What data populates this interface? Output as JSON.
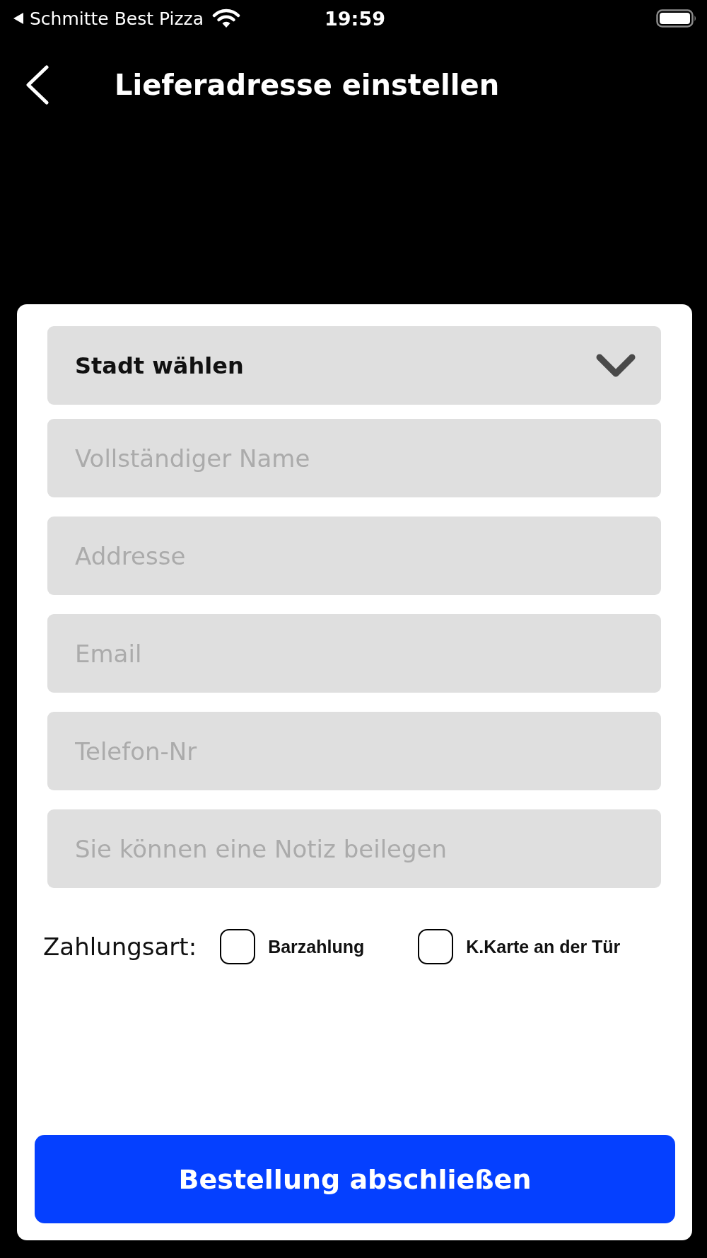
{
  "status_bar": {
    "back_app": "Schmitte Best Pizza",
    "time": "19:59"
  },
  "header": {
    "title": "Lieferadresse einstellen"
  },
  "form": {
    "city_select": {
      "label": "Stadt wählen"
    },
    "fields": [
      {
        "placeholder": "Vollständiger Name"
      },
      {
        "placeholder": "Addresse"
      },
      {
        "placeholder": "Email"
      },
      {
        "placeholder": "Telefon-Nr"
      },
      {
        "placeholder": "Sie können eine Notiz beilegen"
      }
    ],
    "payment": {
      "label": "Zahlungsart:",
      "options": [
        {
          "label": "Barzahlung",
          "checked": false
        },
        {
          "label": "K.Karte an der Tür",
          "checked": false
        }
      ]
    },
    "submit_button": "Bestellung abschließen"
  }
}
